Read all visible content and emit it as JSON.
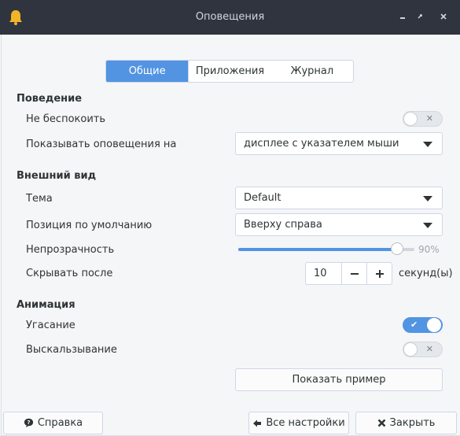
{
  "window": {
    "title": "Оповещения",
    "app_icon": "bell-icon",
    "controls": [
      "minimize-icon",
      "maximize-icon",
      "close-icon"
    ]
  },
  "tabs": [
    {
      "label": "Общие",
      "active": true
    },
    {
      "label": "Приложения",
      "active": false
    },
    {
      "label": "Журнал",
      "active": false
    }
  ],
  "behavior": {
    "heading": "Поведение",
    "dnd_label": "Не беспокоить",
    "dnd_on": false,
    "show_on_label": "Показывать оповещения на",
    "show_on_value": "дисплее с указателем мыши"
  },
  "appearance": {
    "heading": "Внешний вид",
    "theme_label": "Тема",
    "theme_value": "Default",
    "position_label": "Позиция по умолчанию",
    "position_value": "Вверху справа",
    "opacity_label": "Непрозрачность",
    "opacity_value_text": "90%",
    "opacity_fraction": 0.9,
    "hide_after_label": "Скрывать после",
    "hide_after_value": "10",
    "hide_after_unit": "секунд(ы)"
  },
  "animation": {
    "heading": "Анимация",
    "fade_label": "Угасание",
    "fade_on": true,
    "slide_label": "Выскальзывание",
    "slide_on": false
  },
  "buttons": {
    "preview": "Показать пример",
    "help": "Справка",
    "all_settings": "Все настройки",
    "close": "Закрыть"
  },
  "colors": {
    "accent": "#5294e2",
    "titlebar": "#2f343f",
    "bell": "#f0b429"
  }
}
